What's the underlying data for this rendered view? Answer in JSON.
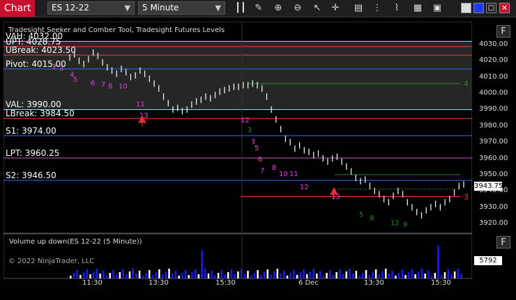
{
  "toolbar": {
    "tab_label": "Chart",
    "symbol": "ES 12-22",
    "interval": "5 Minute",
    "icons": [
      "bar-chart-icon",
      "draw-pencil-icon",
      "zoom-in-icon",
      "zoom-out-icon",
      "cursor-icon",
      "crosshair-icon",
      "data-box-icon",
      "line-style-icon",
      "grid-icon",
      "color-blue-icon",
      "minimize-icon",
      "maximize-icon",
      "close-icon"
    ]
  },
  "chart": {
    "study_title": "Tradesight Seeker and Comber Tool, Tradesight Futures Levels",
    "volume_title": "Volume up down(ES 12-22 (5 Minute))",
    "copyright": "© 2022 NinjaTrader, LLC",
    "f_button": "F",
    "current_price": "3943.75",
    "current_volume": "5792",
    "price_ticks": [
      "4030.00",
      "4020.00",
      "4010.00",
      "4000.00",
      "3990.00",
      "3980.00",
      "3970.00",
      "3960.00",
      "3950.00",
      "3940.00",
      "3930.00",
      "3920.00"
    ],
    "time_ticks": [
      "11:30",
      "13:30",
      "15:30",
      "6 Dec",
      "13:30",
      "15:30"
    ],
    "levels": [
      {
        "label": "VAH: 4032.00",
        "price": 4032.0,
        "color": "#8ee0ff"
      },
      {
        "label": "UPT: 4028.75",
        "price": 4028.75,
        "color": "#ff3b3b"
      },
      {
        "label": "UBreak: 4023.50",
        "price": 4023.5,
        "color": "#ff3b3b"
      },
      {
        "label": "Pivot: 4015.00",
        "price": 4015.0,
        "color": "#2b6bff"
      },
      {
        "label": "VAL: 3990.00",
        "price": 3990.0,
        "color": "#8ee0ff"
      },
      {
        "label": "LBreak: 3984.50",
        "price": 3984.5,
        "color": "#ff3b3b"
      },
      {
        "label": "S1: 3974.00",
        "price": 3974.0,
        "color": "#2b6bff"
      },
      {
        "label": "LPT: 3960.25",
        "price": 3960.25,
        "color": "#c060c0"
      },
      {
        "label": "S2: 3946.50",
        "price": 3946.5,
        "color": "#2b6bff"
      }
    ],
    "right_markers": [
      "4",
      "3"
    ]
  }
}
